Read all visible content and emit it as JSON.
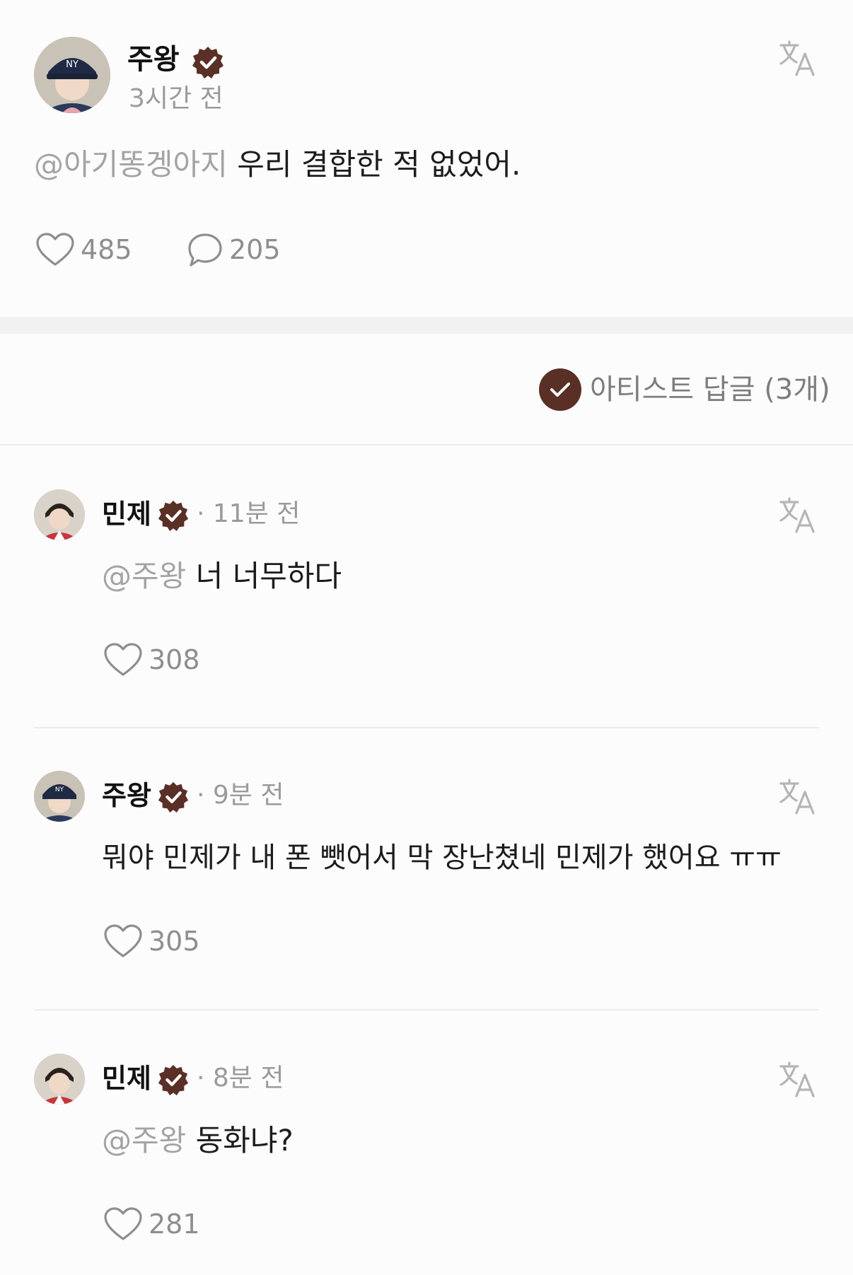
{
  "post": {
    "author": "주왕",
    "time": "3시간 전",
    "mention": "@아기똥겡아지",
    "text": "우리 결합한 적 없었어.",
    "likes": "485",
    "comments": "205"
  },
  "filter": {
    "label": "아티스트 답글 (3개)"
  },
  "replies": [
    {
      "author": "민제",
      "time": "· 11분 전",
      "mention": "@주왕",
      "text": "너 너무하다",
      "likes": "308"
    },
    {
      "author": "주왕",
      "time": "· 9분 전",
      "mention": "",
      "text": "뭐야 민제가 내 폰 뺏어서 막 장난쳤네 민제가 했어요 ㅠㅠ",
      "likes": "305"
    },
    {
      "author": "민제",
      "time": "· 8분 전",
      "mention": "@주왕",
      "text": "동화냐?",
      "likes": "281"
    }
  ],
  "icons": {
    "verified": "verified-badge-icon",
    "translate": "translate-icon",
    "heart": "heart-icon",
    "comment": "comment-bubble-icon",
    "check": "check-icon"
  },
  "colors": {
    "badge": "#5a2f26",
    "muted": "#9a9a9a",
    "background": "#fcfcfc"
  }
}
